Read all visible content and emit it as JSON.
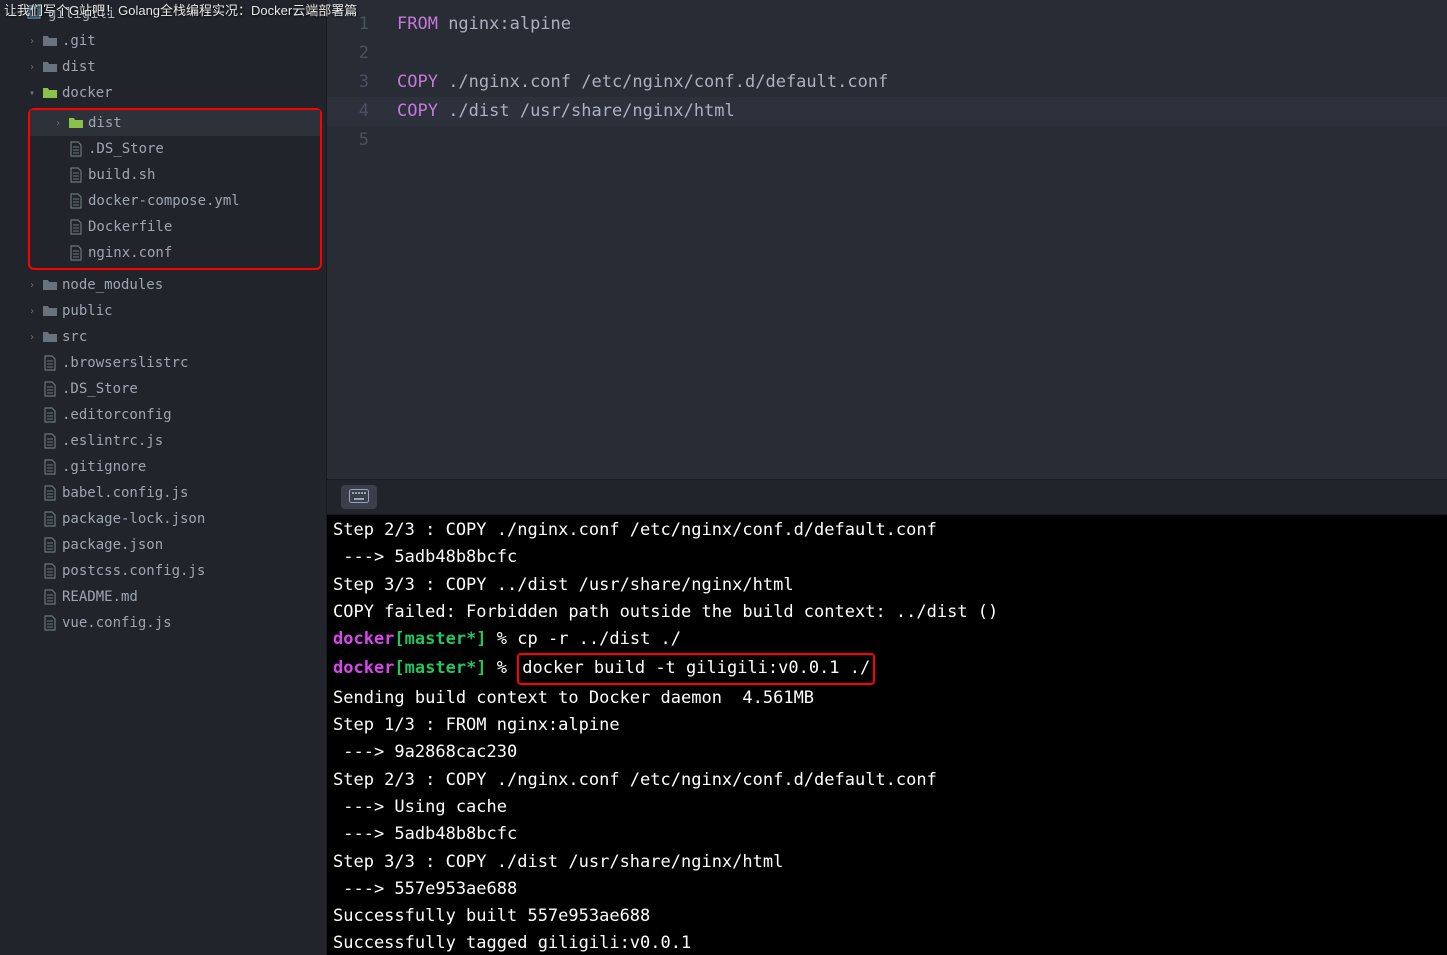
{
  "titleBar": "让我们写个G站吧！Golang全栈编程实况：Docker云端部署篇",
  "project": {
    "name": "giligili"
  },
  "tree": [
    {
      "label": ".git",
      "indent": 1,
      "type": "folder",
      "expand": "closed"
    },
    {
      "label": "dist",
      "indent": 1,
      "type": "folder",
      "expand": "closed"
    },
    {
      "label": "docker",
      "indent": 1,
      "type": "folder",
      "expand": "open"
    }
  ],
  "dockerChildren": [
    {
      "label": "dist",
      "indent": 2,
      "type": "folder",
      "expand": "closed",
      "open": true
    },
    {
      "label": ".DS_Store",
      "indent": 2,
      "type": "file"
    },
    {
      "label": "build.sh",
      "indent": 2,
      "type": "file"
    },
    {
      "label": "docker-compose.yml",
      "indent": 2,
      "type": "file"
    },
    {
      "label": "Dockerfile",
      "indent": 2,
      "type": "file"
    },
    {
      "label": "nginx.conf",
      "indent": 2,
      "type": "file"
    }
  ],
  "treeAfter": [
    {
      "label": "node_modules",
      "indent": 1,
      "type": "folder",
      "expand": "closed"
    },
    {
      "label": "public",
      "indent": 1,
      "type": "folder",
      "expand": "closed"
    },
    {
      "label": "src",
      "indent": 1,
      "type": "folder",
      "expand": "closed"
    },
    {
      "label": ".browserslistrc",
      "indent": 1,
      "type": "file"
    },
    {
      "label": ".DS_Store",
      "indent": 1,
      "type": "file"
    },
    {
      "label": ".editorconfig",
      "indent": 1,
      "type": "file"
    },
    {
      "label": ".eslintrc.js",
      "indent": 1,
      "type": "file"
    },
    {
      "label": ".gitignore",
      "indent": 1,
      "type": "file"
    },
    {
      "label": "babel.config.js",
      "indent": 1,
      "type": "file"
    },
    {
      "label": "package-lock.json",
      "indent": 1,
      "type": "file"
    },
    {
      "label": "package.json",
      "indent": 1,
      "type": "file"
    },
    {
      "label": "postcss.config.js",
      "indent": 1,
      "type": "file"
    },
    {
      "label": "README.md",
      "indent": 1,
      "type": "file"
    },
    {
      "label": "vue.config.js",
      "indent": 1,
      "type": "file"
    }
  ],
  "editorLines": [
    {
      "n": 1,
      "kw": "FROM",
      "rest": " nginx:alpine"
    },
    {
      "n": 2,
      "kw": "",
      "rest": ""
    },
    {
      "n": 3,
      "kw": "COPY",
      "rest": " ./nginx.conf /etc/nginx/conf.d/default.conf"
    },
    {
      "n": 4,
      "kw": "COPY",
      "rest": " ./dist /usr/share/nginx/html",
      "hl": true
    },
    {
      "n": 5,
      "kw": "",
      "rest": ""
    }
  ],
  "terminal": {
    "promptA": "docker",
    "promptB": "[master*]",
    "promptC": " % ",
    "lines": [
      {
        "t": "plain",
        "text": "Step 2/3 : COPY ./nginx.conf /etc/nginx/conf.d/default.conf"
      },
      {
        "t": "plain",
        "text": " ---> 5adb48b8bcfc"
      },
      {
        "t": "plain",
        "text": "Step 3/3 : COPY ../dist /usr/share/nginx/html"
      },
      {
        "t": "plain",
        "text": "COPY failed: Forbidden path outside the build context: ../dist ()"
      },
      {
        "t": "prompt",
        "cmd": "cp -r ../dist ./"
      },
      {
        "t": "prompt-hl",
        "cmd": "docker build -t giligili:v0.0.1 ./"
      },
      {
        "t": "plain",
        "text": "Sending build context to Docker daemon  4.561MB"
      },
      {
        "t": "plain",
        "text": "Step 1/3 : FROM nginx:alpine"
      },
      {
        "t": "plain",
        "text": " ---> 9a2868cac230"
      },
      {
        "t": "plain",
        "text": "Step 2/3 : COPY ./nginx.conf /etc/nginx/conf.d/default.conf"
      },
      {
        "t": "plain",
        "text": " ---> Using cache"
      },
      {
        "t": "plain",
        "text": " ---> 5adb48b8bcfc"
      },
      {
        "t": "plain",
        "text": "Step 3/3 : COPY ./dist /usr/share/nginx/html"
      },
      {
        "t": "plain",
        "text": " ---> 557e953ae688"
      },
      {
        "t": "plain",
        "text": "Successfully built 557e953ae688"
      },
      {
        "t": "plain",
        "text": "Successfully tagged giligili:v0.0.1"
      }
    ]
  }
}
